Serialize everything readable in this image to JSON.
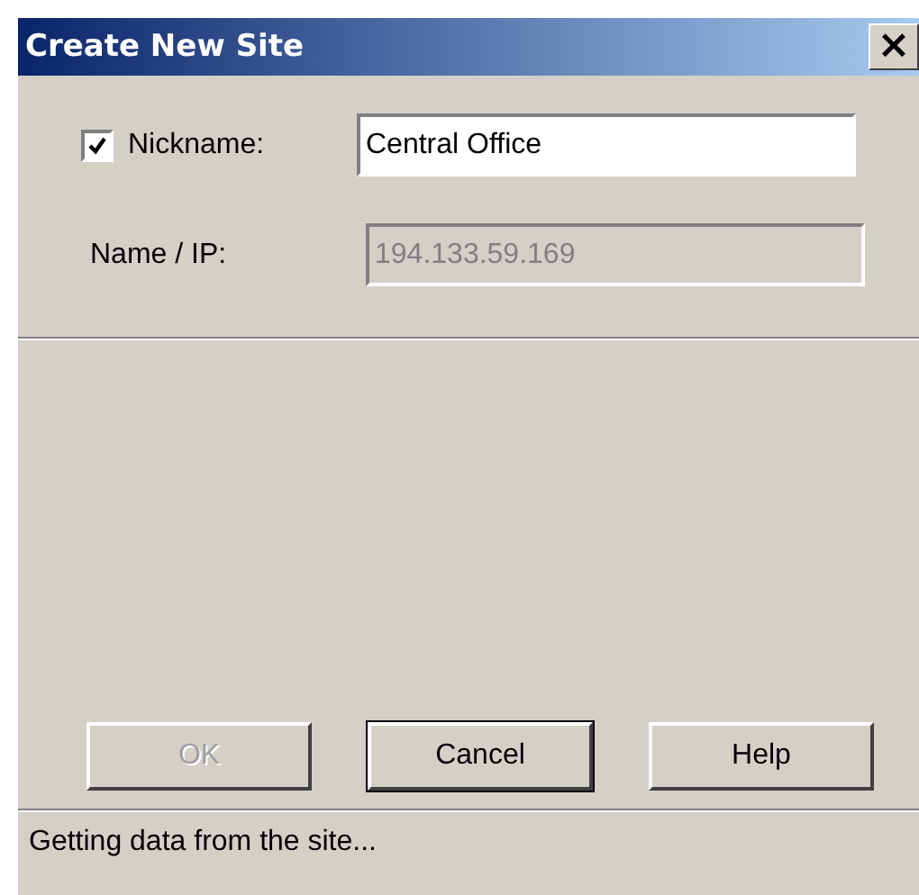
{
  "window": {
    "title": "Create New Site",
    "close": "×"
  },
  "fields": [
    {
      "label": "Nickname:",
      "value": "Central Office",
      "has_checkbox": true,
      "checked": true,
      "disabled": false
    },
    {
      "label": "Name / IP:",
      "value": "194.133.59.169",
      "has_checkbox": false,
      "disabled": true
    }
  ],
  "buttons": [
    {
      "label": "OK",
      "disabled": true,
      "default": false
    },
    {
      "label": "Cancel",
      "disabled": false,
      "default": true
    },
    {
      "label": "Help",
      "disabled": false,
      "default": false
    }
  ],
  "status_bar": "Getting data from the site..."
}
